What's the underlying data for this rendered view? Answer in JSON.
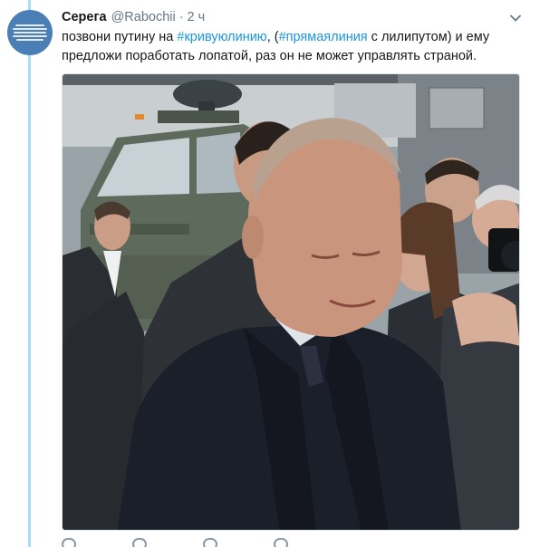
{
  "tweet": {
    "author_name": "Серега",
    "author_handle": "@Rabochii",
    "separator": "·",
    "time": "2 ч",
    "text": {
      "part1": "позвони путину на ",
      "hashtag1": "#кривуюлинию",
      "part2": ", (",
      "hashtag2": "#прямаялиния",
      "part3": " с лилипутом) и ему предложи поработать лопатой, раз он не может управлять страной."
    }
  },
  "icons": {
    "menu": "chevron-down-icon",
    "reply": "reply-icon",
    "retweet": "retweet-icon",
    "like": "heart-icon",
    "message": "direct-message-icon"
  },
  "colors": {
    "hashtag": "#1b95e0",
    "thread_line": "#a9dcf5",
    "meta": "#657786"
  }
}
